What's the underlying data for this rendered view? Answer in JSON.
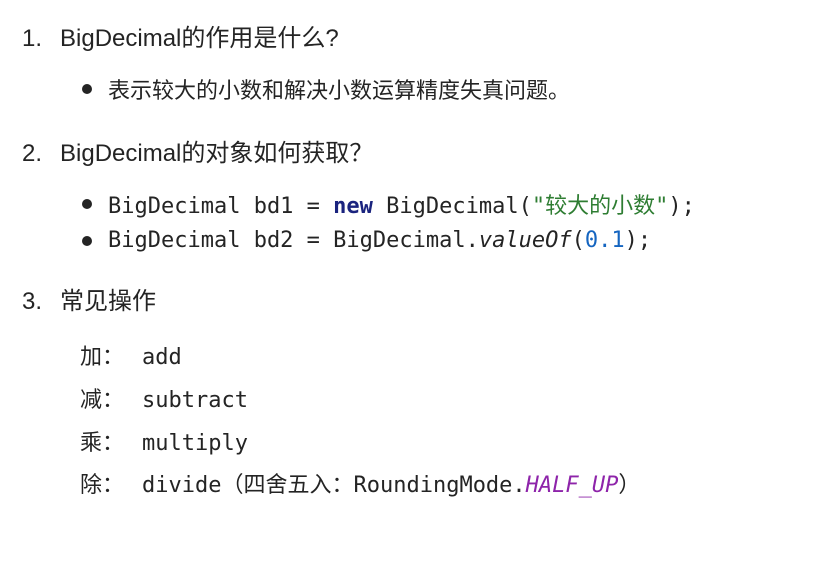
{
  "items": [
    {
      "number": "1.",
      "title": "BigDecimal的作用是什么?",
      "bullets": [
        {
          "type": "text",
          "content": "表示较大的小数和解决小数运算精度失真问题。"
        }
      ]
    },
    {
      "number": "2.",
      "title": "BigDecimal的对象如何获取？",
      "bullets": [
        {
          "type": "code",
          "before": "BigDecimal bd1 = ",
          "kw": "new",
          "mid": " BigDecimal(",
          "str": "\"较大的小数\"",
          "after": ");"
        },
        {
          "type": "code",
          "before": "BigDecimal bd2 = BigDecimal.",
          "method": "valueOf",
          "mid2": "(",
          "numlit": "0.1",
          "after2": ");"
        }
      ]
    },
    {
      "number": "3.",
      "title": "常见操作",
      "ops": [
        {
          "label": "加：",
          "name": "add"
        },
        {
          "label": "减：",
          "name": "subtract"
        },
        {
          "label": "乘：",
          "name": "multiply"
        },
        {
          "label": "除：",
          "name": "divide",
          "extraOpen": "（四舍五入：RoundingMode.",
          "enum": "HALF_UP",
          "extraClose": "）"
        }
      ]
    }
  ]
}
